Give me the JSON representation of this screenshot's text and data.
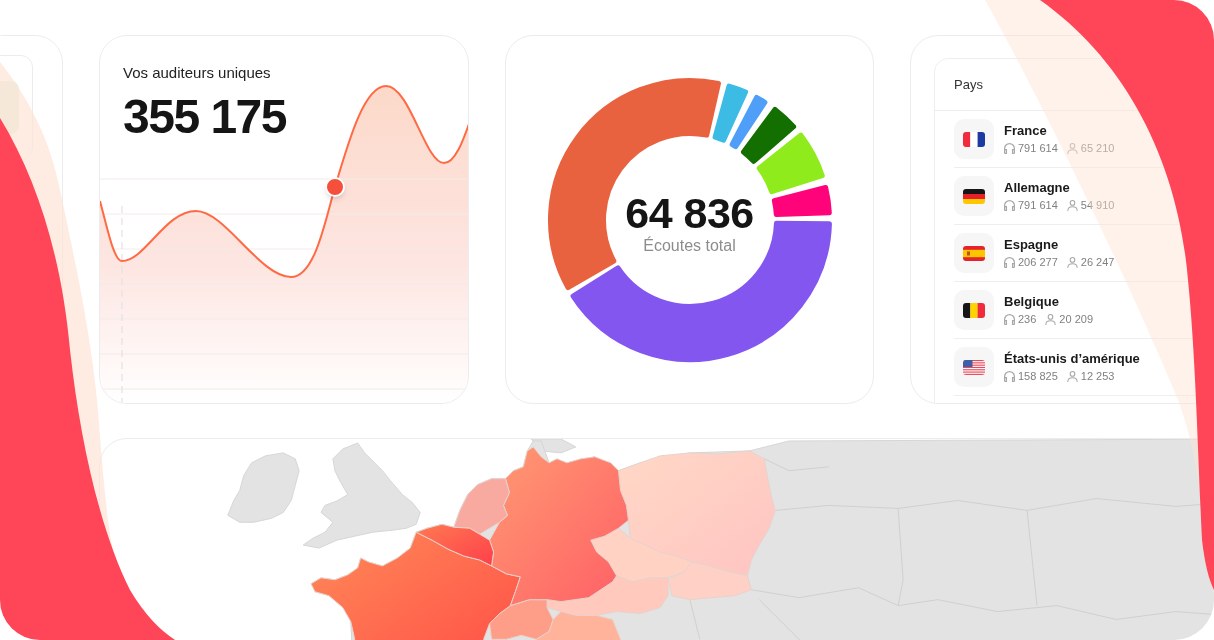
{
  "listeners_card": {
    "title": "Vos auditeurs uniques",
    "value": "355 175"
  },
  "plays_card": {
    "value": "64 836",
    "label": "Écoutes total"
  },
  "countries_card": {
    "header": "Pays",
    "countries": [
      {
        "kind": "fr",
        "name": "France",
        "plays": "791 614",
        "listeners": "65 210"
      },
      {
        "kind": "de",
        "name": "Allemagne",
        "plays": "791 614",
        "listeners": "54 910"
      },
      {
        "kind": "es",
        "name": "Espagne",
        "plays": "206 277",
        "listeners": "26 247"
      },
      {
        "kind": "be",
        "name": "Belgique",
        "plays": "236",
        "listeners": "20 209"
      },
      {
        "kind": "us",
        "name": "États-unis d’amérique",
        "plays": "158 825",
        "listeners": "12 253"
      }
    ]
  }
}
